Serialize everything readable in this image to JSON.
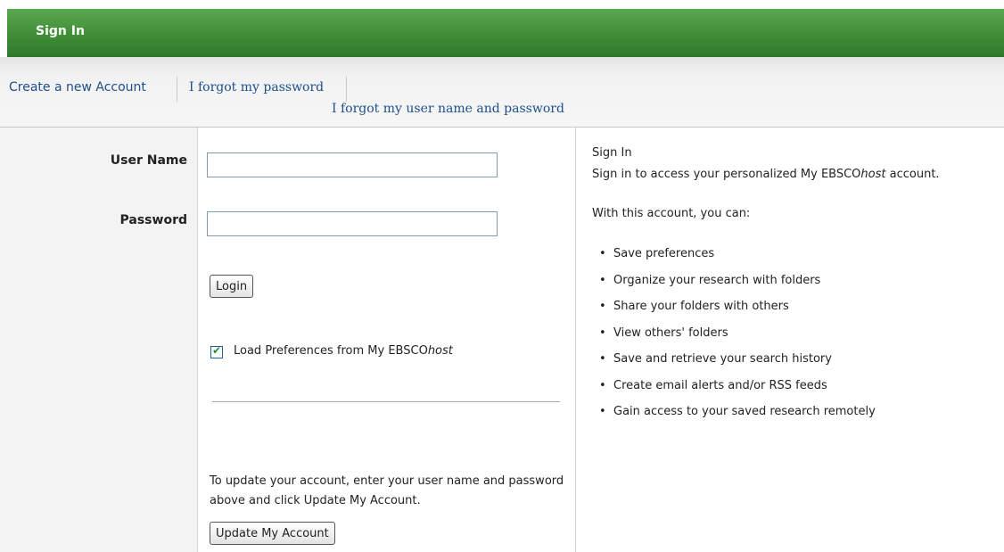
{
  "header": {
    "title": "Sign In"
  },
  "links": {
    "create_account": "Create a new Account",
    "forgot_password": "I forgot my password",
    "forgot_both": "I forgot my user name and password"
  },
  "form": {
    "username_label": "User Name",
    "username_value": "",
    "password_label": "Password",
    "password_value": "",
    "login_button": "Login",
    "load_prefs": {
      "checked": true,
      "label_prefix": "Load Preferences from My EBSCO",
      "label_suffix": "host"
    },
    "update_text": "To update your account, enter your user name and password above and click Update My Account.",
    "update_button": "Update My Account"
  },
  "info": {
    "title": "Sign In",
    "subtitle_prefix": "Sign in to access your personalized My EBSCO",
    "subtitle_host": "host",
    "subtitle_suffix": " account.",
    "intro": "With this account, you can:",
    "benefits": [
      "Save preferences",
      "Organize your research with folders",
      "Share your folders with others",
      "View others' folders",
      "Save and retrieve your search history",
      "Create email alerts and/or RSS feeds",
      "Gain access to your saved research remotely"
    ]
  },
  "colors": {
    "header_green": "#3f8d37",
    "link_blue": "#1d4f8c"
  }
}
